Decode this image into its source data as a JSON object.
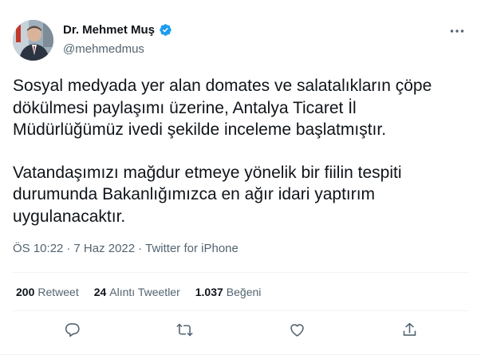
{
  "author": {
    "display_name": "Dr. Mehmet Muş",
    "handle": "@mehmedmus",
    "verified_icon": "verified-badge-icon",
    "verified_color": "#1d9bf0"
  },
  "tweet": {
    "paragraphs": [
      "Sosyal medyada yer alan domates ve salatalıkların çöpe dökülmesi paylaşımı üzerine, Antalya Ticaret İl Müdürlüğümüz ivedi şekilde inceleme başlatmıştır.",
      "Vatandaşımızı mağdur etmeye yönelik bir fiilin tespiti durumunda Bakanlığımızca en ağır idari yaptırım uygulanacaktır."
    ],
    "time": "ÖS 10:22",
    "separator": "·",
    "date": "7 Haz 2022",
    "source": "Twitter for iPhone"
  },
  "stats": {
    "retweets_count": "200",
    "retweets_label": "Retweet",
    "quotes_count": "24",
    "quotes_label": "Alıntı Tweetler",
    "likes_count": "1.037",
    "likes_label": "Beğeni"
  },
  "colors": {
    "text": "#0f1419",
    "secondary": "#536471",
    "divider": "#eff3f4"
  }
}
